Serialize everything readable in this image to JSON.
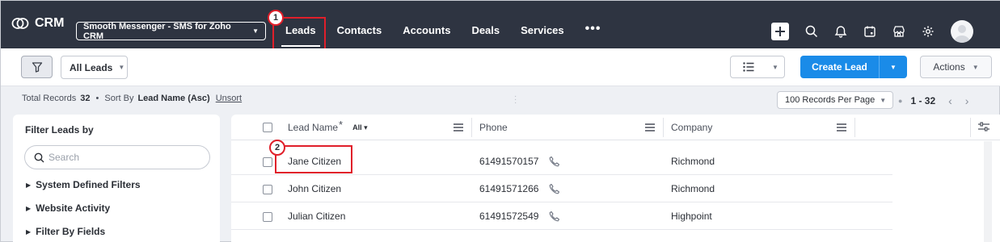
{
  "navbar": {
    "brand": "CRM",
    "app_selector": "Smooth Messenger - SMS for Zoho CRM",
    "tabs": [
      {
        "label": "Leads",
        "active": true
      },
      {
        "label": "Contacts",
        "active": false
      },
      {
        "label": "Accounts",
        "active": false
      },
      {
        "label": "Deals",
        "active": false
      },
      {
        "label": "Services",
        "active": false
      }
    ],
    "more": "•••",
    "icons": [
      "add-icon",
      "search-icon",
      "bell-icon",
      "calendar-icon",
      "marketplace-icon",
      "gear-icon",
      "avatar"
    ],
    "bg_color": "#2e3441"
  },
  "annotations": {
    "step1": "1",
    "step2": "2",
    "color": "#e01f2a"
  },
  "toolbar": {
    "view": "All Leads",
    "create_label": "Create Lead",
    "actions_label": "Actions",
    "accent": "#1a8be8"
  },
  "info": {
    "total_label": "Total Records",
    "total": "32",
    "sort_label": "Sort By",
    "sort_value": "Lead Name (Asc)",
    "unsort": "Unsort",
    "per_page": "100 Records Per Page",
    "range": "1 - 32"
  },
  "sidebar": {
    "title": "Filter Leads by",
    "search_placeholder": "Search",
    "items": [
      "System Defined Filters",
      "Website Activity",
      "Filter By Fields"
    ]
  },
  "table": {
    "columns": {
      "name": "Lead Name",
      "name_required": "*",
      "name_filter": "All",
      "phone": "Phone",
      "company": "Company"
    },
    "rows": [
      {
        "name": "Jane Citizen",
        "phone": "61491570157",
        "company": "Richmond"
      },
      {
        "name": "John Citizen",
        "phone": "61491571266",
        "company": "Richmond"
      },
      {
        "name": "Julian Citizen",
        "phone": "61491572549",
        "company": "Highpoint"
      }
    ]
  }
}
